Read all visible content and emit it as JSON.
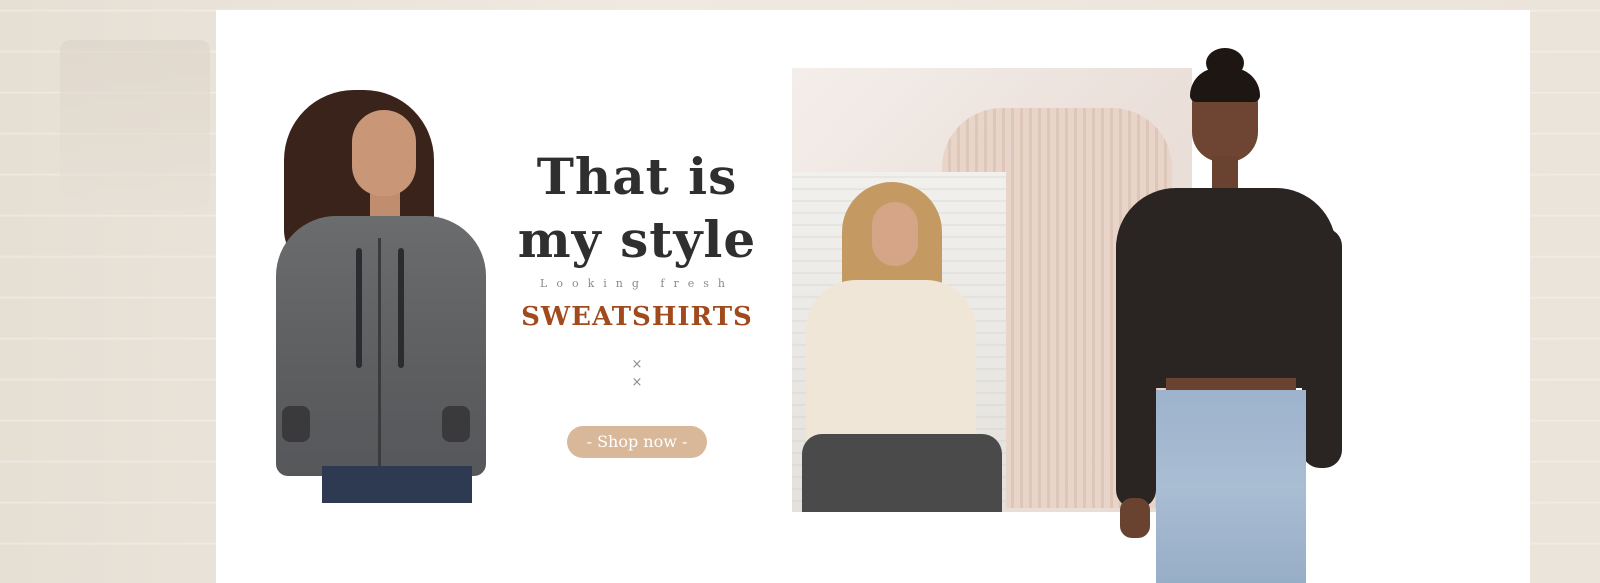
{
  "banner": {
    "headline_line1": "That is",
    "headline_line2": "my style",
    "tagline": "Looking fresh",
    "category": "SWEATSHIRTS",
    "decor_mark_1": "×",
    "decor_mark_2": "×",
    "cta_label": "- Shop now -"
  },
  "colors": {
    "background": "#e9e3da",
    "panel": "#ffffff",
    "headline": "#2f2f2f",
    "category": "#a04a1e",
    "cta_bg": "#d9b899",
    "cta_text": "#ffffff"
  }
}
